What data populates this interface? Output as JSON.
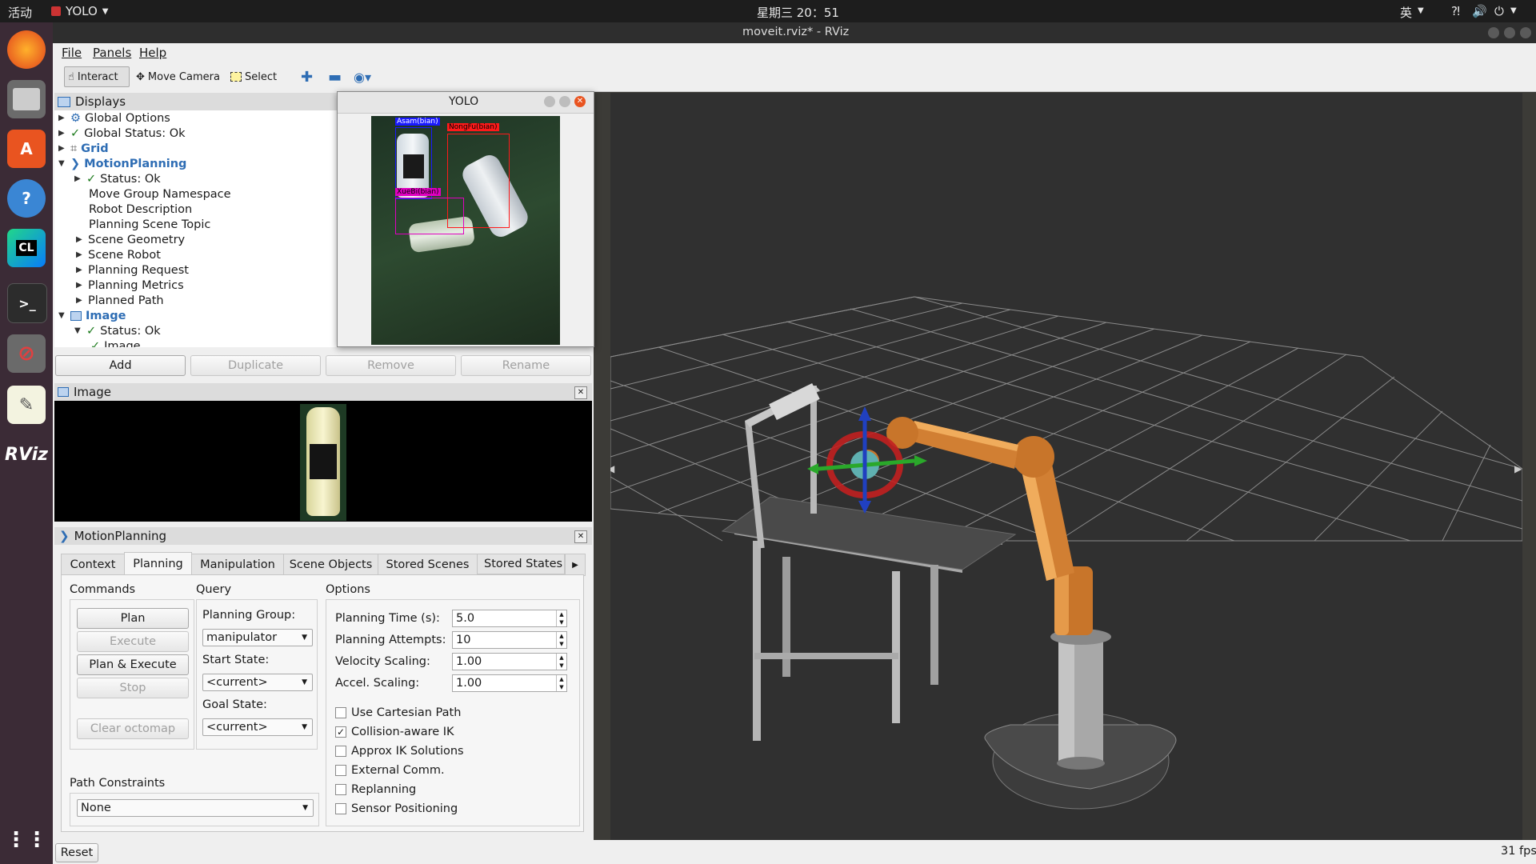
{
  "topbar": {
    "activities": "活动",
    "app_name": "YOLO",
    "clock": "星期三 20：51",
    "input_method": "英"
  },
  "window": {
    "title": "moveit.rviz* - RViz"
  },
  "menu": {
    "file": "File",
    "panels": "Panels",
    "help": "Help"
  },
  "toolbar": {
    "interact": "Interact",
    "move_camera": "Move Camera",
    "select": "Select"
  },
  "displays": {
    "title": "Displays",
    "items": [
      {
        "label": "Global Options"
      },
      {
        "label": "Global Status: Ok"
      },
      {
        "label": "Grid"
      },
      {
        "label": "MotionPlanning"
      },
      {
        "label": "Status: Ok"
      },
      {
        "label": "Move Group Namespace"
      },
      {
        "label": "Robot Description"
      },
      {
        "label": "Planning Scene Topic"
      },
      {
        "label": "Scene Geometry"
      },
      {
        "label": "Scene Robot"
      },
      {
        "label": "Planning Request"
      },
      {
        "label": "Planning Metrics"
      },
      {
        "label": "Planned Path"
      },
      {
        "label": "Image"
      },
      {
        "label": "Status: Ok"
      },
      {
        "label": "Image"
      }
    ],
    "buttons": {
      "add": "Add",
      "duplicate": "Duplicate",
      "remove": "Remove",
      "rename": "Rename"
    }
  },
  "yolo_window": {
    "title": "YOLO",
    "detections": [
      {
        "label": "Asam(bian)",
        "color": "#1a1aff"
      },
      {
        "label": "NongFu(bian)",
        "color": "#ff1a1a"
      },
      {
        "label": "XueBi(bian)",
        "color": "#e000c0"
      }
    ]
  },
  "image_panel": {
    "title": "Image"
  },
  "motion_panel": {
    "title": "MotionPlanning",
    "tabs": [
      "Context",
      "Planning",
      "Manipulation",
      "Scene Objects",
      "Stored Scenes",
      "Stored States"
    ],
    "active_tab": "Planning",
    "commands": {
      "heading": "Commands",
      "plan": "Plan",
      "execute": "Execute",
      "plan_execute": "Plan & Execute",
      "stop": "Stop",
      "clear_octomap": "Clear octomap"
    },
    "query": {
      "heading": "Query",
      "planning_group_label": "Planning Group:",
      "planning_group": "manipulator",
      "start_state_label": "Start State:",
      "start_state": "<current>",
      "goal_state_label": "Goal State:",
      "goal_state": "<current>"
    },
    "options": {
      "heading": "Options",
      "planning_time_label": "Planning Time (s):",
      "planning_time": "5.0",
      "planning_attempts_label": "Planning Attempts:",
      "planning_attempts": "10",
      "velocity_label": "Velocity Scaling:",
      "velocity": "1.00",
      "accel_label": "Accel. Scaling:",
      "accel": "1.00",
      "checks": [
        {
          "label": "Use Cartesian Path",
          "checked": false
        },
        {
          "label": "Collision-aware IK",
          "checked": true
        },
        {
          "label": "Approx IK Solutions",
          "checked": false
        },
        {
          "label": "External Comm.",
          "checked": false
        },
        {
          "label": "Replanning",
          "checked": false
        },
        {
          "label": "Sensor Positioning",
          "checked": false
        }
      ]
    },
    "path_constraints": {
      "label": "Path Constraints",
      "value": "None"
    }
  },
  "footer": {
    "reset": "Reset",
    "fps": "31 fps"
  }
}
